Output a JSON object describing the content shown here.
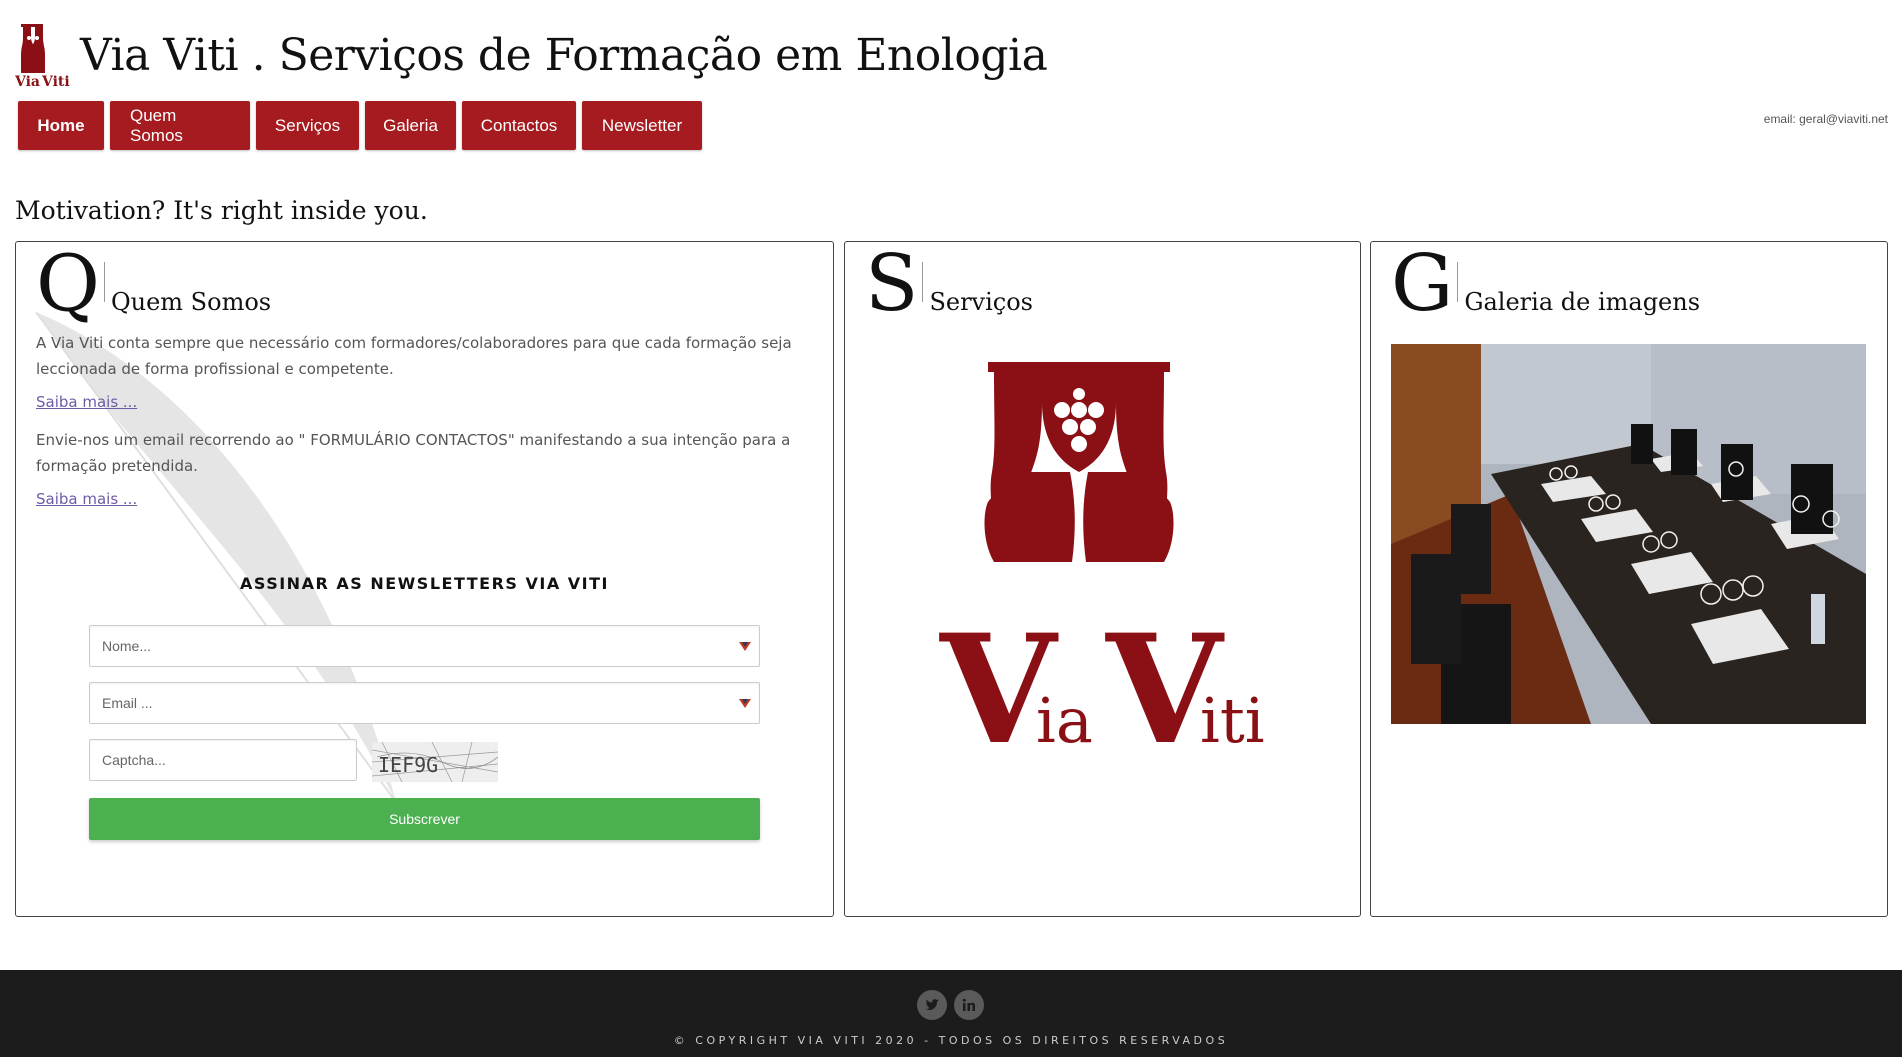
{
  "header": {
    "logo_text_1": "Via",
    "logo_text_2": "Viti",
    "title": "Via Viti . Serviços de Formação em Enologia"
  },
  "nav": {
    "items": [
      {
        "label": "Home",
        "active": true
      },
      {
        "label": "Quem Somos",
        "active": false
      },
      {
        "label": "Serviços",
        "active": false
      },
      {
        "label": "Galeria",
        "active": false
      },
      {
        "label": "Contactos",
        "active": false
      },
      {
        "label": "Newsletter",
        "active": false
      }
    ]
  },
  "contact_email": "email: geral@viaviti.net",
  "tagline": "Motivation? It's right inside you.",
  "panels": {
    "quem_somos": {
      "letter": "Q",
      "title": "Quem Somos",
      "paragraph_1": "A Via Viti conta sempre que necessário com formadores/colaboradores para que cada formação seja leccionada de forma profissional e competente.",
      "link_1": "Saiba mais ...",
      "paragraph_2": "Envie-nos um email recorrendo ao \" FORMULÁRIO CONTACTOS\" manifestando a sua intenção para a formação pretendida.",
      "link_2": "Saiba mais ..."
    },
    "servicos": {
      "letter": "S",
      "title": "Serviços",
      "logo_text_1": "Via",
      "logo_text_2": "Viti"
    },
    "galeria": {
      "letter": "G",
      "title": "Galeria de imagens"
    }
  },
  "newsletter": {
    "title": "ASSINAR AS NEWSLETTERS VIA VITI",
    "name_placeholder": "Nome...",
    "email_placeholder": "Email ...",
    "captcha_placeholder": "Captcha...",
    "captcha_code": "IEF9G",
    "subscribe_label": "Subscrever"
  },
  "footer": {
    "copyright": "© COPYRIGHT VIA VITI 2020 - TODOS OS DIREITOS RESERVADOS",
    "social_icons": [
      "twitter-icon",
      "linkedin-icon"
    ]
  },
  "colors": {
    "brand_red": "#a61b1f",
    "logo_red": "#8b1015",
    "subscribe_green": "#4caf50",
    "footer_bg": "#1c1c1c",
    "link_purple": "#6f5aa8"
  }
}
